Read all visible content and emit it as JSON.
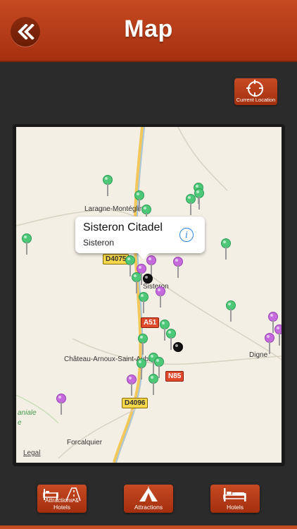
{
  "header": {
    "title": "Map"
  },
  "current_location": {
    "label": "Current Location"
  },
  "map": {
    "towns": [
      "Laragne-Montéglin",
      "Sisteron",
      "Château-Arnoux-Saint-Auban",
      "Digne",
      "Forcalquier",
      "aniale",
      "e"
    ],
    "roads": [
      "D4075",
      "A51",
      "N85",
      "D4096"
    ],
    "legal": "Legal",
    "callout": {
      "title": "Sisteron Citadel",
      "subtitle": "Sisteron"
    }
  },
  "tabs": [
    {
      "label": "Attractions & Hotels"
    },
    {
      "label": "Attractions"
    },
    {
      "label": "Hotels"
    }
  ],
  "colors": {
    "accent": "#b83c18",
    "background": "#2c2b2b",
    "pin_green": "#4cc878",
    "pin_purple": "#c46adc"
  }
}
